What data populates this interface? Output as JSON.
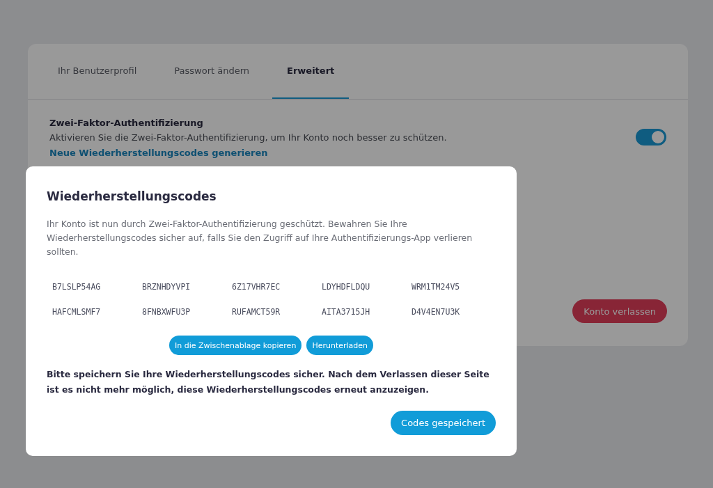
{
  "tabs": [
    {
      "label": "Ihr Benutzerprofil",
      "selected": false
    },
    {
      "label": "Passwort ändern",
      "selected": false
    },
    {
      "label": "Erweitert",
      "selected": true
    }
  ],
  "two_factor": {
    "title": "Zwei-Faktor-Authentifizierung",
    "description": "Aktivieren Sie die Zwei-Faktor-Authentifizierung, um Ihr Konto noch besser zu schützen.",
    "link": "Neue Wiederherstellungscodes generieren",
    "on": true
  },
  "leave_button": "Konto verlassen",
  "dialog": {
    "title": "Wiederherstellungscodes",
    "description": "Ihr Konto ist nun durch Zwei-Faktor-Authentifizierung geschützt. Bewahren Sie Ihre Wiederherstellungscodes sicher auf, falls Sie den Zugriff auf Ihre Authentifizierungs-App verlieren sollten.",
    "codes": [
      "B7LSLP54AG",
      "BRZNHDYVPI",
      "6Z17VHR7EC",
      "LDYHDFLDQU",
      "WRM1TM24V5",
      "HAFCMLSMF7",
      "8FNBXWFU3P",
      "RUFAMCT59R",
      "AITA3715JH",
      "D4V4EN7U3K"
    ],
    "actions": [
      "In die Zwischenablage kopieren",
      "Herunterladen"
    ],
    "warning": "Bitte speichern Sie Ihre Wiederherstellungscodes sicher. Nach dem Verlassen dieser Seite ist es nicht mehr möglich, diese Wiederherstellungscodes erneut anzuzeigen.",
    "confirm": "Codes gespeichert"
  }
}
